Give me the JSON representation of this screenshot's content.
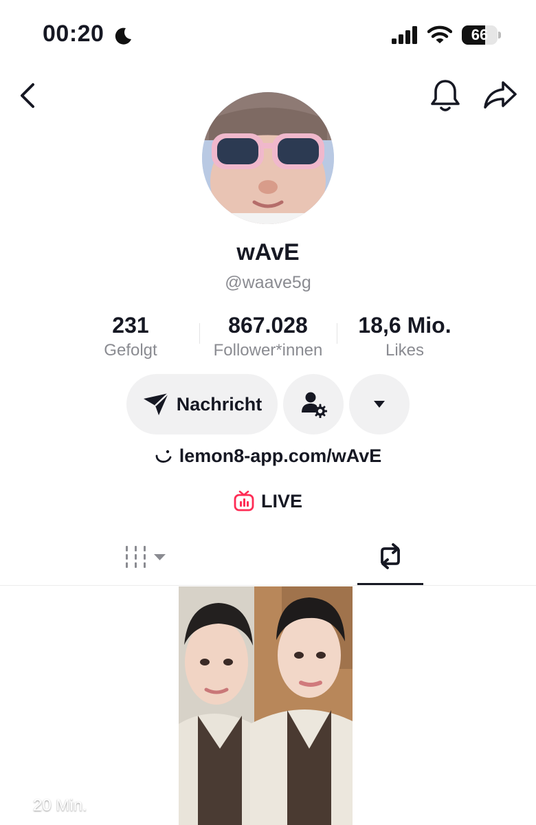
{
  "status_bar": {
    "time": "00:20",
    "battery_percent": 66,
    "battery_label": "66",
    "icons": [
      "moon-icon",
      "signal-icon",
      "wifi-icon",
      "battery-icon"
    ]
  },
  "nav": {
    "icons": [
      "back-icon",
      "bell-icon",
      "share-icon"
    ]
  },
  "profile": {
    "display_name": "wAvE",
    "handle": "@waave5g"
  },
  "stats": [
    {
      "value": "231",
      "label": "Gefolgt"
    },
    {
      "value": "867.028",
      "label": "Follower*innen"
    },
    {
      "value": "18,6 Mio.",
      "label": "Likes"
    }
  ],
  "actions": {
    "message_label": "Nachricht",
    "icons": [
      "send-icon",
      "friend-settings-icon",
      "caret-down-icon"
    ]
  },
  "bio_link": "lemon8-app.com/wAvE",
  "live_label": "LIVE",
  "tabs": [
    {
      "name": "videos",
      "icon": "grid-icon",
      "active": false
    },
    {
      "name": "reposts",
      "icon": "repost-icon",
      "active": true
    }
  ],
  "videos": [
    {
      "repost_time": "20 Min."
    }
  ],
  "colors": {
    "text": "#161823",
    "secondary": "#8a8b91",
    "button_bg": "#f1f1f2",
    "live_accent": "#fe2c55"
  }
}
